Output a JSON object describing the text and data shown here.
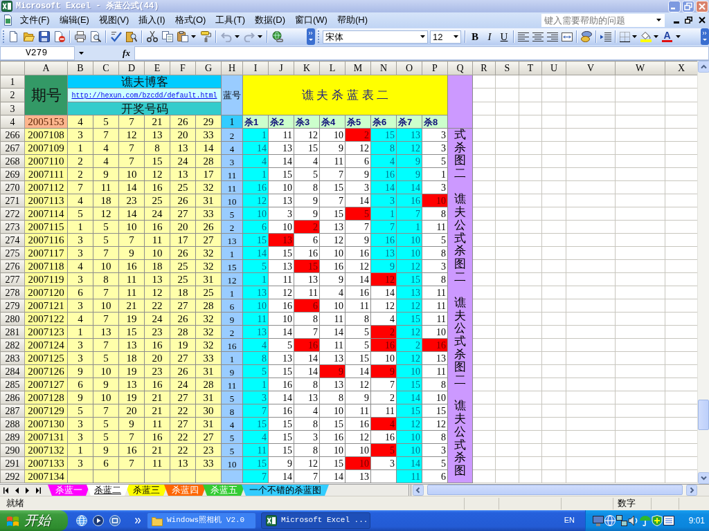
{
  "window": {
    "title": "Microsoft Excel - 杀蓝公式(44)"
  },
  "menu": [
    "文件(F)",
    "编辑(E)",
    "视图(V)",
    "插入(I)",
    "格式(O)",
    "工具(T)",
    "数据(D)",
    "窗口(W)",
    "帮助(H)"
  ],
  "help_search": {
    "placeholder": "键入需要帮助的问题"
  },
  "formatting_toolbar": {
    "font": "宋体",
    "size": "12",
    "bold": "B",
    "italic": "I",
    "underline": "U",
    "font_color": "A"
  },
  "formula_bar": {
    "name_box": "V279",
    "function_label": "fx"
  },
  "columns": [
    "A",
    "B",
    "C",
    "D",
    "E",
    "F",
    "G",
    "H",
    "I",
    "J",
    "K",
    "L",
    "M",
    "N",
    "O",
    "P",
    "Q",
    "R",
    "S",
    "T",
    "U",
    "V",
    "W",
    "X"
  ],
  "header_rows": {
    "row_numbers": [
      "1",
      "2",
      "3",
      "4"
    ],
    "issue_title": "期号",
    "blog_title": "谯夫博客",
    "blog_link": "http://hexun.com/bzcdd/default.html",
    "draw_title": "开奖号码",
    "blue_title": "蓝号",
    "table_title": "谯 夫 杀 蓝 表 二"
  },
  "first_row": {
    "issue": "2005153",
    "draw": [
      "4",
      "5",
      "7",
      "21",
      "26",
      "29"
    ],
    "blue": "1",
    "kill_headers": [
      "杀1",
      "杀2",
      "杀3",
      "杀4",
      "杀5",
      "杀6",
      "杀7",
      "杀8"
    ]
  },
  "rows": [
    {
      "number": "266",
      "issue": "2007108",
      "draw": [
        "3",
        "7",
        "12",
        "13",
        "20",
        "33"
      ],
      "blue": "2",
      "kills": [
        {
          "text": "1",
          "color": "#00ffff"
        },
        {
          "text": "11",
          "color": "#ffffff"
        },
        {
          "text": "12",
          "color": "#ffffff"
        },
        {
          "text": "10",
          "color": "#ffffff"
        },
        {
          "text": "2",
          "color": "#ff0000"
        },
        {
          "text": "15",
          "color": "#00ffff"
        },
        {
          "text": "13",
          "color": "#00ffff"
        },
        {
          "text": "3",
          "color": "#ffffff"
        }
      ]
    },
    {
      "number": "267",
      "issue": "2007109",
      "draw": [
        "1",
        "4",
        "7",
        "8",
        "13",
        "14"
      ],
      "blue": "4",
      "kills": [
        {
          "text": "14",
          "color": "#00ffff"
        },
        {
          "text": "13",
          "color": "#ffffff"
        },
        {
          "text": "15",
          "color": "#ffffff"
        },
        {
          "text": "9",
          "color": "#ffffff"
        },
        {
          "text": "12",
          "color": "#ffffff"
        },
        {
          "text": "8",
          "color": "#00ffff"
        },
        {
          "text": "12",
          "color": "#00ffff"
        },
        {
          "text": "3",
          "color": "#ffffff"
        }
      ]
    },
    {
      "number": "268",
      "issue": "2007110",
      "draw": [
        "2",
        "4",
        "7",
        "15",
        "24",
        "28"
      ],
      "blue": "3",
      "kills": [
        {
          "text": "4",
          "color": "#00ffff"
        },
        {
          "text": "14",
          "color": "#ffffff"
        },
        {
          "text": "4",
          "color": "#ffffff"
        },
        {
          "text": "11",
          "color": "#ffffff"
        },
        {
          "text": "6",
          "color": "#ffffff"
        },
        {
          "text": "4",
          "color": "#00ffff"
        },
        {
          "text": "9",
          "color": "#00ffff"
        },
        {
          "text": "5",
          "color": "#ffffff"
        }
      ]
    },
    {
      "number": "269",
      "issue": "2007111",
      "draw": [
        "2",
        "9",
        "10",
        "12",
        "13",
        "17"
      ],
      "blue": "11",
      "kills": [
        {
          "text": "1",
          "color": "#00ffff"
        },
        {
          "text": "15",
          "color": "#ffffff"
        },
        {
          "text": "5",
          "color": "#ffffff"
        },
        {
          "text": "7",
          "color": "#ffffff"
        },
        {
          "text": "9",
          "color": "#ffffff"
        },
        {
          "text": "16",
          "color": "#00ffff"
        },
        {
          "text": "9",
          "color": "#00ffff"
        },
        {
          "text": "1",
          "color": "#ffffff"
        }
      ]
    },
    {
      "number": "270",
      "issue": "2007112",
      "draw": [
        "7",
        "11",
        "14",
        "16",
        "25",
        "32"
      ],
      "blue": "11",
      "kills": [
        {
          "text": "16",
          "color": "#00ffff"
        },
        {
          "text": "10",
          "color": "#ffffff"
        },
        {
          "text": "8",
          "color": "#ffffff"
        },
        {
          "text": "15",
          "color": "#ffffff"
        },
        {
          "text": "3",
          "color": "#ffffff"
        },
        {
          "text": "14",
          "color": "#00ffff"
        },
        {
          "text": "14",
          "color": "#00ffff"
        },
        {
          "text": "3",
          "color": "#ffffff"
        }
      ]
    },
    {
      "number": "271",
      "issue": "2007113",
      "draw": [
        "4",
        "18",
        "23",
        "25",
        "26",
        "31"
      ],
      "blue": "10",
      "kills": [
        {
          "text": "12",
          "color": "#00ffff"
        },
        {
          "text": "13",
          "color": "#ffffff"
        },
        {
          "text": "9",
          "color": "#ffffff"
        },
        {
          "text": "7",
          "color": "#ffffff"
        },
        {
          "text": "14",
          "color": "#ffffff"
        },
        {
          "text": "3",
          "color": "#00ffff"
        },
        {
          "text": "16",
          "color": "#00ffff"
        },
        {
          "text": "10",
          "color": "#ff0000"
        }
      ]
    },
    {
      "number": "272",
      "issue": "2007114",
      "draw": [
        "5",
        "12",
        "14",
        "24",
        "27",
        "33"
      ],
      "blue": "5",
      "kills": [
        {
          "text": "10",
          "color": "#00ffff"
        },
        {
          "text": "3",
          "color": "#ffffff"
        },
        {
          "text": "9",
          "color": "#ffffff"
        },
        {
          "text": "15",
          "color": "#ffffff"
        },
        {
          "text": "5",
          "color": "#ff0000"
        },
        {
          "text": "1",
          "color": "#00ffff"
        },
        {
          "text": "7",
          "color": "#00ffff"
        },
        {
          "text": "8",
          "color": "#ffffff"
        }
      ]
    },
    {
      "number": "273",
      "issue": "2007115",
      "draw": [
        "1",
        "5",
        "10",
        "16",
        "20",
        "26"
      ],
      "blue": "2",
      "kills": [
        {
          "text": "6",
          "color": "#00ffff"
        },
        {
          "text": "10",
          "color": "#ffffff"
        },
        {
          "text": "2",
          "color": "#ff0000"
        },
        {
          "text": "13",
          "color": "#ffffff"
        },
        {
          "text": "7",
          "color": "#ffffff"
        },
        {
          "text": "7",
          "color": "#00ffff"
        },
        {
          "text": "1",
          "color": "#00ffff"
        },
        {
          "text": "11",
          "color": "#ffffff"
        }
      ]
    },
    {
      "number": "274",
      "issue": "2007116",
      "draw": [
        "3",
        "5",
        "7",
        "11",
        "17",
        "27"
      ],
      "blue": "13",
      "kills": [
        {
          "text": "15",
          "color": "#00ffff"
        },
        {
          "text": "13",
          "color": "#ff0000"
        },
        {
          "text": "6",
          "color": "#ffffff"
        },
        {
          "text": "12",
          "color": "#ffffff"
        },
        {
          "text": "9",
          "color": "#ffffff"
        },
        {
          "text": "16",
          "color": "#00ffff"
        },
        {
          "text": "10",
          "color": "#00ffff"
        },
        {
          "text": "5",
          "color": "#ffffff"
        }
      ]
    },
    {
      "number": "275",
      "issue": "2007117",
      "draw": [
        "3",
        "7",
        "9",
        "10",
        "26",
        "32"
      ],
      "blue": "1",
      "kills": [
        {
          "text": "14",
          "color": "#00ffff"
        },
        {
          "text": "15",
          "color": "#ffffff"
        },
        {
          "text": "16",
          "color": "#ffffff"
        },
        {
          "text": "10",
          "color": "#ffffff"
        },
        {
          "text": "16",
          "color": "#ffffff"
        },
        {
          "text": "13",
          "color": "#00ffff"
        },
        {
          "text": "10",
          "color": "#00ffff"
        },
        {
          "text": "8",
          "color": "#ffffff"
        }
      ]
    },
    {
      "number": "276",
      "issue": "2007118",
      "draw": [
        "4",
        "10",
        "16",
        "18",
        "25",
        "32"
      ],
      "blue": "15",
      "kills": [
        {
          "text": "5",
          "color": "#00ffff"
        },
        {
          "text": "13",
          "color": "#ffffff"
        },
        {
          "text": "15",
          "color": "#ff0000"
        },
        {
          "text": "16",
          "color": "#ffffff"
        },
        {
          "text": "12",
          "color": "#ffffff"
        },
        {
          "text": "9",
          "color": "#00ffff"
        },
        {
          "text": "12",
          "color": "#00ffff"
        },
        {
          "text": "3",
          "color": "#ffffff"
        }
      ]
    },
    {
      "number": "277",
      "issue": "2007119",
      "draw": [
        "3",
        "8",
        "11",
        "13",
        "25",
        "31"
      ],
      "blue": "12",
      "kills": [
        {
          "text": "1",
          "color": "#00ffff"
        },
        {
          "text": "11",
          "color": "#ffffff"
        },
        {
          "text": "13",
          "color": "#ffffff"
        },
        {
          "text": "9",
          "color": "#ffffff"
        },
        {
          "text": "14",
          "color": "#ffffff"
        },
        {
          "text": "12",
          "color": "#ff0000"
        },
        {
          "text": "15",
          "color": "#00ffff"
        },
        {
          "text": "8",
          "color": "#ffffff"
        }
      ]
    },
    {
      "number": "278",
      "issue": "2007120",
      "draw": [
        "6",
        "7",
        "11",
        "12",
        "18",
        "25"
      ],
      "blue": "1",
      "kills": [
        {
          "text": "13",
          "color": "#00ffff"
        },
        {
          "text": "12",
          "color": "#ffffff"
        },
        {
          "text": "11",
          "color": "#ffffff"
        },
        {
          "text": "4",
          "color": "#ffffff"
        },
        {
          "text": "16",
          "color": "#ffffff"
        },
        {
          "text": "14",
          "color": "#ffffff"
        },
        {
          "text": "13",
          "color": "#00ffff"
        },
        {
          "text": "11",
          "color": "#ffffff"
        }
      ]
    },
    {
      "number": "279",
      "issue": "2007121",
      "draw": [
        "3",
        "10",
        "21",
        "22",
        "27",
        "28"
      ],
      "blue": "6",
      "kills": [
        {
          "text": "10",
          "color": "#00ffff"
        },
        {
          "text": "16",
          "color": "#ffffff"
        },
        {
          "text": "6",
          "color": "#ff0000"
        },
        {
          "text": "10",
          "color": "#ffffff"
        },
        {
          "text": "11",
          "color": "#ffffff"
        },
        {
          "text": "12",
          "color": "#ffffff"
        },
        {
          "text": "12",
          "color": "#00ffff"
        },
        {
          "text": "11",
          "color": "#ffffff"
        }
      ]
    },
    {
      "number": "280",
      "issue": "2007122",
      "draw": [
        "4",
        "7",
        "19",
        "24",
        "26",
        "32"
      ],
      "blue": "9",
      "kills": [
        {
          "text": "11",
          "color": "#00ffff"
        },
        {
          "text": "10",
          "color": "#ffffff"
        },
        {
          "text": "8",
          "color": "#ffffff"
        },
        {
          "text": "11",
          "color": "#ffffff"
        },
        {
          "text": "8",
          "color": "#ffffff"
        },
        {
          "text": "4",
          "color": "#ffffff"
        },
        {
          "text": "15",
          "color": "#00ffff"
        },
        {
          "text": "11",
          "color": "#ffffff"
        }
      ]
    },
    {
      "number": "281",
      "issue": "2007123",
      "draw": [
        "1",
        "13",
        "15",
        "23",
        "28",
        "32"
      ],
      "blue": "2",
      "kills": [
        {
          "text": "13",
          "color": "#00ffff"
        },
        {
          "text": "14",
          "color": "#ffffff"
        },
        {
          "text": "7",
          "color": "#ffffff"
        },
        {
          "text": "14",
          "color": "#ffffff"
        },
        {
          "text": "5",
          "color": "#ffffff"
        },
        {
          "text": "2",
          "color": "#ff0000"
        },
        {
          "text": "12",
          "color": "#00ffff"
        },
        {
          "text": "10",
          "color": "#ffffff"
        }
      ]
    },
    {
      "number": "282",
      "issue": "2007124",
      "draw": [
        "3",
        "7",
        "13",
        "16",
        "19",
        "32"
      ],
      "blue": "16",
      "kills": [
        {
          "text": "4",
          "color": "#00ffff"
        },
        {
          "text": "5",
          "color": "#ffffff"
        },
        {
          "text": "16",
          "color": "#ff0000"
        },
        {
          "text": "11",
          "color": "#ffffff"
        },
        {
          "text": "5",
          "color": "#ffffff"
        },
        {
          "text": "16",
          "color": "#ff0000"
        },
        {
          "text": "2",
          "color": "#00ffff"
        },
        {
          "text": "16",
          "color": "#ff0000"
        }
      ]
    },
    {
      "number": "283",
      "issue": "2007125",
      "draw": [
        "3",
        "5",
        "18",
        "20",
        "27",
        "33"
      ],
      "blue": "1",
      "kills": [
        {
          "text": "8",
          "color": "#00ffff"
        },
        {
          "text": "13",
          "color": "#ffffff"
        },
        {
          "text": "14",
          "color": "#ffffff"
        },
        {
          "text": "13",
          "color": "#ffffff"
        },
        {
          "text": "15",
          "color": "#ffffff"
        },
        {
          "text": "10",
          "color": "#ffffff"
        },
        {
          "text": "12",
          "color": "#00ffff"
        },
        {
          "text": "13",
          "color": "#ffffff"
        }
      ]
    },
    {
      "number": "284",
      "issue": "2007126",
      "draw": [
        "9",
        "10",
        "19",
        "23",
        "26",
        "31"
      ],
      "blue": "9",
      "kills": [
        {
          "text": "5",
          "color": "#00ffff"
        },
        {
          "text": "15",
          "color": "#ffffff"
        },
        {
          "text": "14",
          "color": "#ffffff"
        },
        {
          "text": "9",
          "color": "#ff0000"
        },
        {
          "text": "14",
          "color": "#ffffff"
        },
        {
          "text": "9",
          "color": "#ff0000"
        },
        {
          "text": "10",
          "color": "#00ffff"
        },
        {
          "text": "11",
          "color": "#ffffff"
        }
      ]
    },
    {
      "number": "285",
      "issue": "2007127",
      "draw": [
        "6",
        "9",
        "13",
        "16",
        "24",
        "28"
      ],
      "blue": "11",
      "kills": [
        {
          "text": "1",
          "color": "#00ffff"
        },
        {
          "text": "16",
          "color": "#ffffff"
        },
        {
          "text": "8",
          "color": "#ffffff"
        },
        {
          "text": "13",
          "color": "#ffffff"
        },
        {
          "text": "12",
          "color": "#ffffff"
        },
        {
          "text": "7",
          "color": "#ffffff"
        },
        {
          "text": "15",
          "color": "#00ffff"
        },
        {
          "text": "8",
          "color": "#ffffff"
        }
      ]
    },
    {
      "number": "286",
      "issue": "2007128",
      "draw": [
        "9",
        "10",
        "19",
        "21",
        "27",
        "31"
      ],
      "blue": "5",
      "kills": [
        {
          "text": "3",
          "color": "#00ffff"
        },
        {
          "text": "14",
          "color": "#ffffff"
        },
        {
          "text": "13",
          "color": "#ffffff"
        },
        {
          "text": "8",
          "color": "#ffffff"
        },
        {
          "text": "9",
          "color": "#ffffff"
        },
        {
          "text": "2",
          "color": "#ffffff"
        },
        {
          "text": "14",
          "color": "#00ffff"
        },
        {
          "text": "10",
          "color": "#ffffff"
        }
      ]
    },
    {
      "number": "287",
      "issue": "2007129",
      "draw": [
        "5",
        "7",
        "20",
        "21",
        "22",
        "30"
      ],
      "blue": "8",
      "kills": [
        {
          "text": "7",
          "color": "#00ffff"
        },
        {
          "text": "16",
          "color": "#ffffff"
        },
        {
          "text": "4",
          "color": "#ffffff"
        },
        {
          "text": "10",
          "color": "#ffffff"
        },
        {
          "text": "11",
          "color": "#ffffff"
        },
        {
          "text": "11",
          "color": "#ffffff"
        },
        {
          "text": "15",
          "color": "#00ffff"
        },
        {
          "text": "15",
          "color": "#ffffff"
        }
      ]
    },
    {
      "number": "288",
      "issue": "2007130",
      "draw": [
        "3",
        "5",
        "9",
        "11",
        "27",
        "31"
      ],
      "blue": "4",
      "kills": [
        {
          "text": "15",
          "color": "#00ffff"
        },
        {
          "text": "15",
          "color": "#ffffff"
        },
        {
          "text": "8",
          "color": "#ffffff"
        },
        {
          "text": "15",
          "color": "#ffffff"
        },
        {
          "text": "16",
          "color": "#ffffff"
        },
        {
          "text": "4",
          "color": "#ff0000"
        },
        {
          "text": "12",
          "color": "#00ffff"
        },
        {
          "text": "12",
          "color": "#ffffff"
        }
      ]
    },
    {
      "number": "289",
      "issue": "2007131",
      "draw": [
        "3",
        "5",
        "7",
        "16",
        "22",
        "27"
      ],
      "blue": "5",
      "kills": [
        {
          "text": "4",
          "color": "#00ffff"
        },
        {
          "text": "15",
          "color": "#ffffff"
        },
        {
          "text": "3",
          "color": "#ffffff"
        },
        {
          "text": "16",
          "color": "#ffffff"
        },
        {
          "text": "12",
          "color": "#ffffff"
        },
        {
          "text": "16",
          "color": "#ffffff"
        },
        {
          "text": "10",
          "color": "#00ffff"
        },
        {
          "text": "8",
          "color": "#ffffff"
        }
      ]
    },
    {
      "number": "290",
      "issue": "2007132",
      "draw": [
        "1",
        "9",
        "16",
        "21",
        "22",
        "23"
      ],
      "blue": "5",
      "kills": [
        {
          "text": "11",
          "color": "#00ffff"
        },
        {
          "text": "15",
          "color": "#ffffff"
        },
        {
          "text": "8",
          "color": "#ffffff"
        },
        {
          "text": "10",
          "color": "#ffffff"
        },
        {
          "text": "10",
          "color": "#ffffff"
        },
        {
          "text": "5",
          "color": "#ff0000"
        },
        {
          "text": "10",
          "color": "#00ffff"
        },
        {
          "text": "3",
          "color": "#ffffff"
        }
      ]
    },
    {
      "number": "291",
      "issue": "2007133",
      "draw": [
        "3",
        "6",
        "7",
        "11",
        "13",
        "33"
      ],
      "blue": "10",
      "kills": [
        {
          "text": "15",
          "color": "#00ffff"
        },
        {
          "text": "9",
          "color": "#ffffff"
        },
        {
          "text": "12",
          "color": "#ffffff"
        },
        {
          "text": "15",
          "color": "#ffffff"
        },
        {
          "text": "10",
          "color": "#ff0000"
        },
        {
          "text": "3",
          "color": "#ffffff"
        },
        {
          "text": "14",
          "color": "#00ffff"
        },
        {
          "text": "5",
          "color": "#ffffff"
        }
      ]
    },
    {
      "number": "292",
      "issue": "2007134",
      "kills": [
        {
          "text": "7",
          "color": "#00ffff"
        },
        {
          "text": "14",
          "color": "#ffffff"
        },
        {
          "text": "7",
          "color": "#ffffff"
        },
        {
          "text": "14",
          "color": "#ffffff"
        },
        {
          "text": "13",
          "color": "#ffffff"
        },
        {
          "color": "#ffffff"
        },
        {
          "text": "11",
          "color": "#00ffff"
        },
        {
          "text": "6",
          "color": "#ffffff"
        }
      ]
    }
  ],
  "side_notes": [
    "式杀图二",
    "谯夫公式杀图二",
    "谯夫公式杀图二",
    "谯夫公式杀图"
  ],
  "sheet_tabs": [
    {
      "label": "杀蓝一",
      "color": "#ff00ff",
      "selected": false
    },
    {
      "label": "杀蓝二",
      "selected": true
    },
    {
      "label": "杀蓝三",
      "color": "#ffff00",
      "selected": false
    },
    {
      "label": "杀蓝四",
      "color": "#ff6600",
      "selected": false
    },
    {
      "label": "杀蓝五",
      "color": "#33cc33",
      "selected": false
    },
    {
      "label": "一个不错的杀蓝图",
      "color": "#33ccff",
      "selected": false
    }
  ],
  "status_bar": {
    "status": "就绪",
    "indicator": "数字"
  },
  "taskbar": {
    "start": "开始",
    "tasks": [
      {
        "label": "Windows照相机 V2.0",
        "selected": false
      },
      {
        "label": "Microsoft Excel ...",
        "selected": true
      }
    ],
    "language": "EN",
    "clock": "9:01"
  }
}
